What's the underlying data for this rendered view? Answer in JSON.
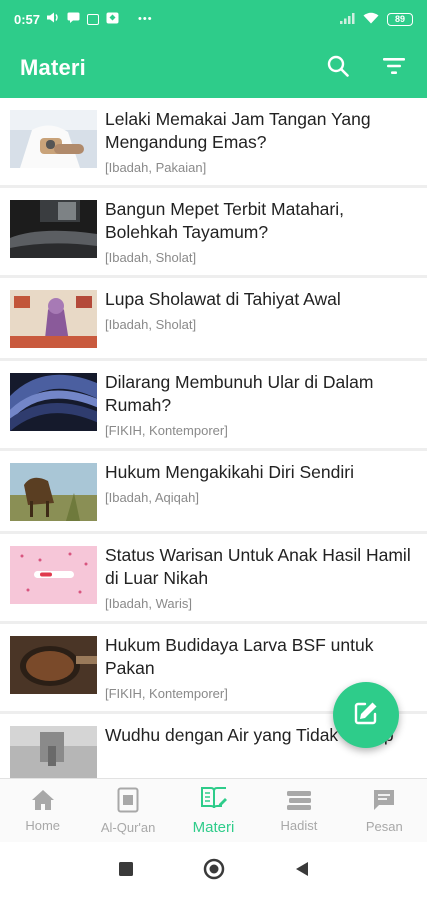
{
  "status_bar": {
    "time": "0:57",
    "battery": "89"
  },
  "app_bar": {
    "title": "Materi"
  },
  "items": [
    {
      "title": "Lelaki Memakai Jam Tangan Yang Mengandung Emas?",
      "tags": "[Ibadah, Pakaian]"
    },
    {
      "title": "Bangun Mepet Terbit Matahari, Bolehkah Tayamum?",
      "tags": "[Ibadah, Sholat]"
    },
    {
      "title": "Lupa Sholawat di Tahiyat Awal",
      "tags": "[Ibadah, Sholat]"
    },
    {
      "title": "Dilarang Membunuh Ular di Dalam Rumah?",
      "tags": "[FIKIH, Kontemporer]"
    },
    {
      "title": "Hukum Mengakikahi Diri Sendiri",
      "tags": "[Ibadah, Aqiqah]"
    },
    {
      "title": "Status Warisan Untuk Anak Hasil Hamil di Luar Nikah",
      "tags": "[Ibadah, Waris]"
    },
    {
      "title": "Hukum Budidaya Larva BSF untuk Pakan",
      "tags": "[FIKIH, Kontemporer]"
    },
    {
      "title": "Wudhu dengan Air yang Tidak Cukup",
      "tags": ""
    }
  ],
  "bottom_nav": [
    {
      "label": "Home",
      "icon": "home-icon"
    },
    {
      "label": "Al-Qur'an",
      "icon": "quran-icon"
    },
    {
      "label": "Materi",
      "icon": "book-edit-icon"
    },
    {
      "label": "Hadist",
      "icon": "books-stack-icon"
    },
    {
      "label": "Pesan",
      "icon": "message-icon"
    }
  ],
  "colors": {
    "primary": "#2ecc8a",
    "inactive": "#a8a8a8"
  }
}
